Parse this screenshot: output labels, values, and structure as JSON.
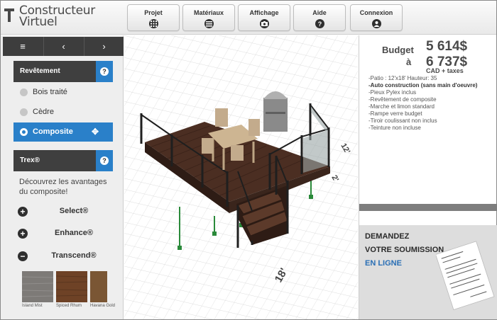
{
  "app": {
    "logo_line1": "Constructeur",
    "logo_line2": "Virtuel"
  },
  "nav": [
    {
      "label": "Projet",
      "icon": "grid-icon"
    },
    {
      "label": "Matériaux",
      "icon": "list-icon"
    },
    {
      "label": "Affichage",
      "icon": "camera-icon"
    },
    {
      "label": "Aide",
      "icon": "help-icon"
    },
    {
      "label": "Connexion",
      "icon": "user-icon"
    }
  ],
  "left": {
    "toolbar": {
      "menu": "≡",
      "prev": "‹",
      "next": "›"
    },
    "surface_title": "Revêtement",
    "surface_options": [
      {
        "label": "Bois traité",
        "selected": false
      },
      {
        "label": "Cèdre",
        "selected": false
      },
      {
        "label": "Composite",
        "selected": true
      }
    ],
    "brand_title": "Trex®",
    "brand_description": "Découvrez les avantages du composite!",
    "series": [
      {
        "label": "Select®",
        "state": "+"
      },
      {
        "label": "Enhance®",
        "state": "+"
      },
      {
        "label": "Transcend®",
        "state": "−"
      }
    ],
    "swatches": [
      {
        "label": "Island Mist",
        "color": "#7d7a77"
      },
      {
        "label": "Spiced Rhum",
        "color": "#6e4226"
      },
      {
        "label": "Havana Gold",
        "color": "#7a5634"
      }
    ]
  },
  "canvas": {
    "dim_depth": "12'",
    "dim_height": "2'",
    "dim_width": "18'"
  },
  "right": {
    "budget_label": "Budget",
    "price_low": "5 614$",
    "between_label": "à",
    "price_high": "6 737$",
    "tax_note": "CAD + taxes",
    "details": [
      {
        "text": "-Patio : 12'x18'  Hauteur: 35",
        "bold": false
      },
      {
        "text": "-Auto construction (sans main d'oeuvre)",
        "bold": true
      },
      {
        "text": "-Pieux Pylex inclus",
        "bold": false
      },
      {
        "text": "-Revêtement de composite",
        "bold": false
      },
      {
        "text": "-Marche et limon standard",
        "bold": false
      },
      {
        "text": "-Rampe verre budget",
        "bold": false
      },
      {
        "text": "-Tiroir coulissant non inclus",
        "bold": false
      },
      {
        "text": "-Teinture non incluse",
        "bold": false
      }
    ],
    "promo_line1": "DEMANDEZ",
    "promo_line2": "VOTRE SOUMISSION",
    "promo_line3": "EN LIGNE"
  },
  "colors": {
    "accent": "#2a80c9",
    "dark": "#3d3d3d",
    "deck": "#4b2e22",
    "post": "#2a8a3a"
  }
}
